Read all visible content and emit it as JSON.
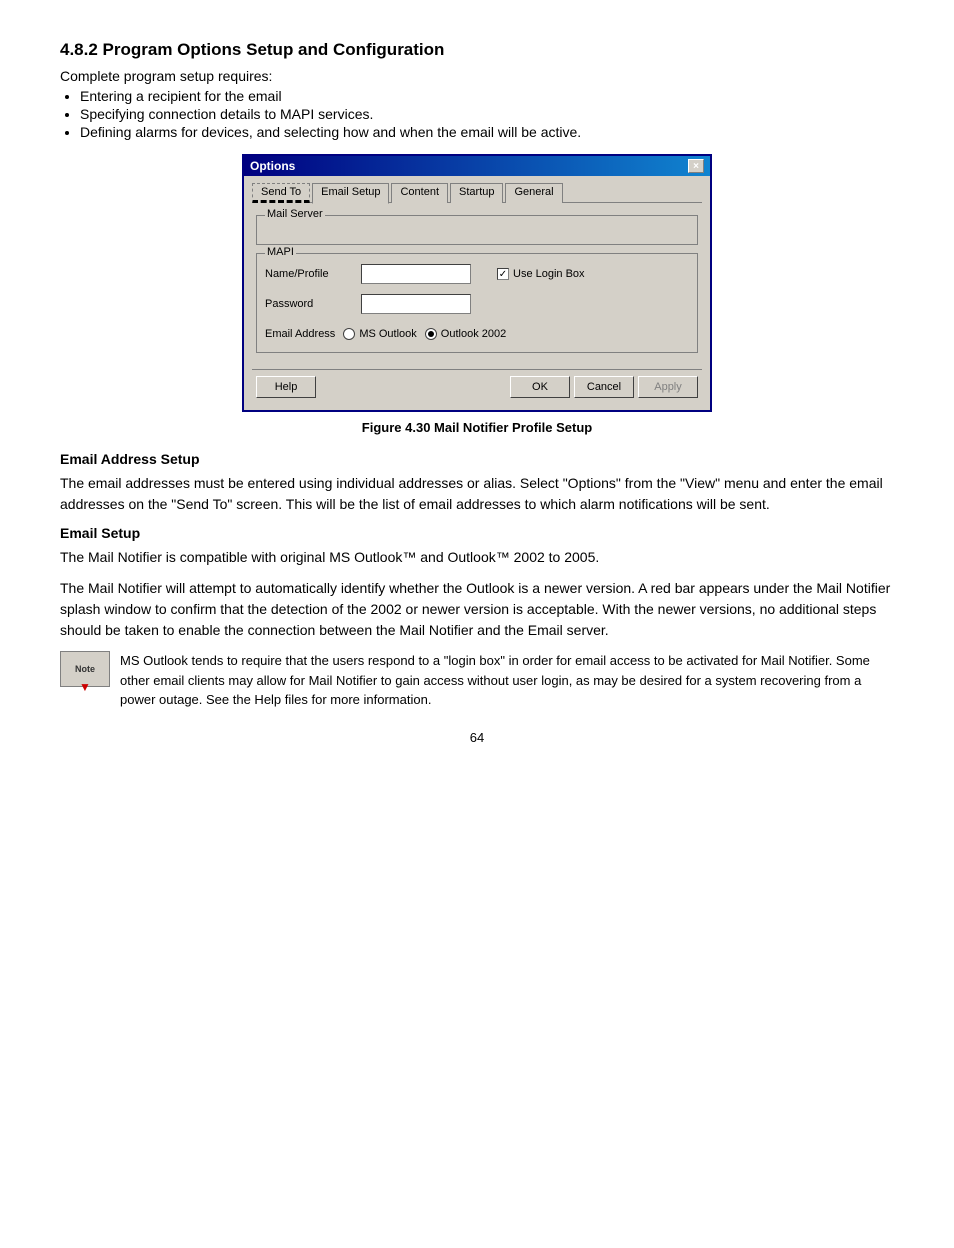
{
  "section": {
    "heading": "4.8.2  Program Options Setup and Configuration",
    "intro": "Complete program setup requires:",
    "bullets": [
      "Entering a recipient for the email",
      "Specifying connection details to MAPI services.",
      "Defining alarms for devices, and selecting how and when the email will be active."
    ]
  },
  "dialog": {
    "title": "Options",
    "close_label": "×",
    "tabs": [
      {
        "label": "Send To",
        "active": false,
        "dashed": true
      },
      {
        "label": "Email Setup",
        "active": true,
        "dashed": false
      },
      {
        "label": "Content",
        "active": false,
        "dashed": false
      },
      {
        "label": "Startup",
        "active": false,
        "dashed": false
      },
      {
        "label": "General",
        "active": false,
        "dashed": false
      }
    ],
    "mail_server_label": "Mail Server",
    "mapi_label": "MAPI",
    "name_profile_label": "Name/Profile",
    "name_profile_value": "",
    "use_login_box_label": "Use Login Box",
    "use_login_box_checked": true,
    "password_label": "Password",
    "password_value": "",
    "email_address_label": "Email Address",
    "radio_ms_outlook": "MS Outlook",
    "radio_outlook_2002": "Outlook 2002",
    "buttons": {
      "help": "Help",
      "ok": "OK",
      "cancel": "Cancel",
      "apply": "Apply"
    }
  },
  "figure_caption": "Figure 4.30  Mail Notifier Profile Setup",
  "email_address_setup": {
    "heading": "Email Address Setup",
    "paragraph": "The email addresses must be entered using individual addresses or alias. Select \"Options\" from the \"View\" menu and enter the email addresses on the \"Send To\" screen. This will be the list of email addresses to which alarm notifications will be sent."
  },
  "email_setup": {
    "heading": "Email Setup",
    "paragraph1": "The Mail Notifier is compatible with original MS Outlook™ and Outlook™ 2002 to 2005.",
    "paragraph2": "The Mail Notifier will attempt to automatically identify whether the Outlook is a newer version.  A red bar appears under the Mail Notifier splash window to confirm that the detection of the 2002 or newer version is acceptable.  With the newer versions, no additional steps should be taken to enable the connection between the Mail Notifier and the Email server."
  },
  "note": {
    "icon_text": "Note",
    "text": "MS Outlook tends to require that the users respond to a \"login box\" in order for email access to be activated for Mail Notifier.  Some other email clients may allow for Mail Notifier to gain access without user login, as may be desired for a system recovering from a power outage.  See the Help files for more information."
  },
  "page_number": "64"
}
